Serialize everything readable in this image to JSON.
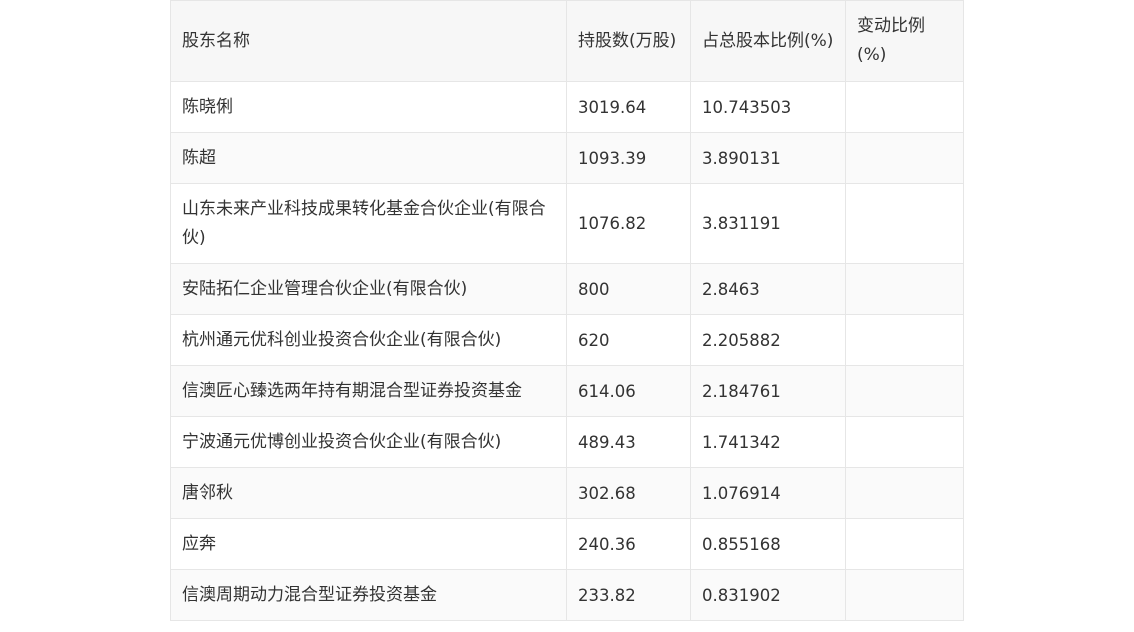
{
  "table": {
    "headers": [
      "股东名称",
      "持股数(万股)",
      "占总股本比例(%)",
      "变动比例(%)"
    ],
    "rows": [
      {
        "name": "陈晓俐",
        "shares": "3019.64",
        "ratio": "10.743503",
        "change": ""
      },
      {
        "name": "陈超",
        "shares": "1093.39",
        "ratio": "3.890131",
        "change": ""
      },
      {
        "name": "山东未来产业科技成果转化基金合伙企业(有限合伙)",
        "shares": "1076.82",
        "ratio": "3.831191",
        "change": ""
      },
      {
        "name": "安陆拓仁企业管理合伙企业(有限合伙)",
        "shares": "800",
        "ratio": "2.8463",
        "change": ""
      },
      {
        "name": "杭州通元优科创业投资合伙企业(有限合伙)",
        "shares": "620",
        "ratio": "2.205882",
        "change": ""
      },
      {
        "name": "信澳匠心臻选两年持有期混合型证券投资基金",
        "shares": "614.06",
        "ratio": "2.184761",
        "change": ""
      },
      {
        "name": "宁波通元优博创业投资合伙企业(有限合伙)",
        "shares": "489.43",
        "ratio": "1.741342",
        "change": ""
      },
      {
        "name": "唐邻秋",
        "shares": "302.68",
        "ratio": "1.076914",
        "change": ""
      },
      {
        "name": "应奔",
        "shares": "240.36",
        "ratio": "0.855168",
        "change": ""
      },
      {
        "name": "信澳周期动力混合型证券投资基金",
        "shares": "233.82",
        "ratio": "0.831902",
        "change": ""
      }
    ]
  }
}
